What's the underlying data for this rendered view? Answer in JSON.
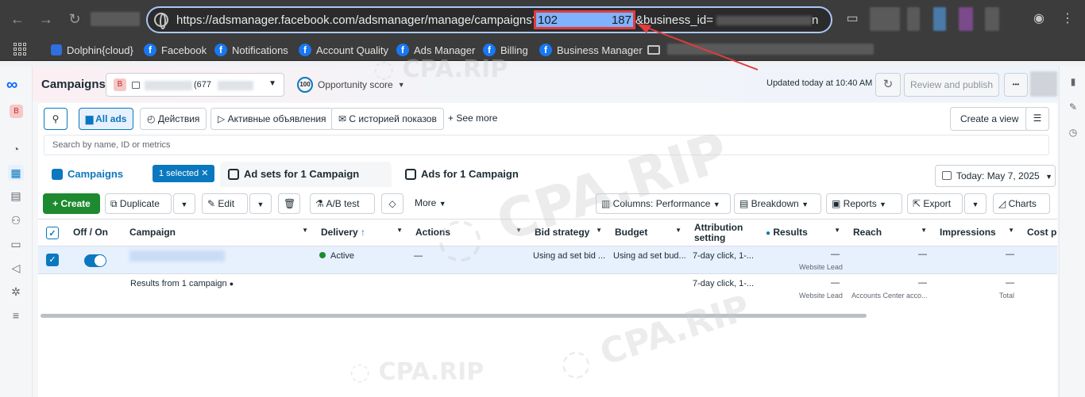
{
  "browser": {
    "url_prefix": "https://adsmanager.facebook.com/adsmanager/manage/campaigns?act=",
    "url_act_start": "102",
    "url_act_end": "187",
    "url_suffix": "&business_id=",
    "url_tail": "n",
    "bookmarks": [
      "Dolphin{cloud}",
      "Facebook",
      "Notifications",
      "Account Quality",
      "Ads Manager",
      "Billing",
      "Business Manager"
    ]
  },
  "header": {
    "title": "Campaigns",
    "account_initial": "B",
    "account_name_partial": "(677",
    "opportunity_badge": "100",
    "opportunity_label": "Opportunity score",
    "updated": "Updated today at 10:40 AM",
    "review_publish": "Review and publish",
    "more": "•••"
  },
  "toolbar": {
    "all_ads": "All ads",
    "filter1": "Действия",
    "filter2": "Активные объявления",
    "filter3": "С историей показов",
    "see_more": "See more",
    "create_view": "Create a view",
    "search_placeholder": "Search by name, ID or metrics"
  },
  "tabs": {
    "campaigns": "Campaigns",
    "selected": "1 selected",
    "adsets": "Ad sets for 1 Campaign",
    "ads": "Ads for 1 Campaign",
    "date": "Today: May 7, 2025"
  },
  "actions": {
    "create": "Create",
    "duplicate": "Duplicate",
    "edit": "Edit",
    "ab_test": "A/B test",
    "more": "More",
    "columns": "Columns: Performance",
    "breakdown": "Breakdown",
    "reports": "Reports",
    "export": "Export",
    "charts": "Charts"
  },
  "table": {
    "headers": [
      "Off / On",
      "Campaign",
      "Delivery",
      "Actions",
      "Bid strategy",
      "Budget",
      "Attribution setting",
      "Results",
      "Reach",
      "Impressions",
      "Cost pe"
    ],
    "row1": {
      "delivery": "Active",
      "actions": "—",
      "bid": "Using ad set bid ...",
      "budget": "Using ad set bud...",
      "attribution": "7-day click, 1-...",
      "results": "—",
      "results_sub": "Website Lead",
      "reach": "—",
      "impressions": "—"
    },
    "row2": {
      "label": "Results from 1 campaign",
      "attribution": "7-day click, 1-...",
      "results": "—",
      "results_sub": "Website Lead",
      "reach": "—",
      "reach_sub": "Accounts Center acco...",
      "impressions": "—",
      "impressions_sub": "Total"
    }
  },
  "colors": {
    "accent": "#0a78be",
    "create": "#1d8a2f",
    "highlight_border": "#e23c3c"
  }
}
